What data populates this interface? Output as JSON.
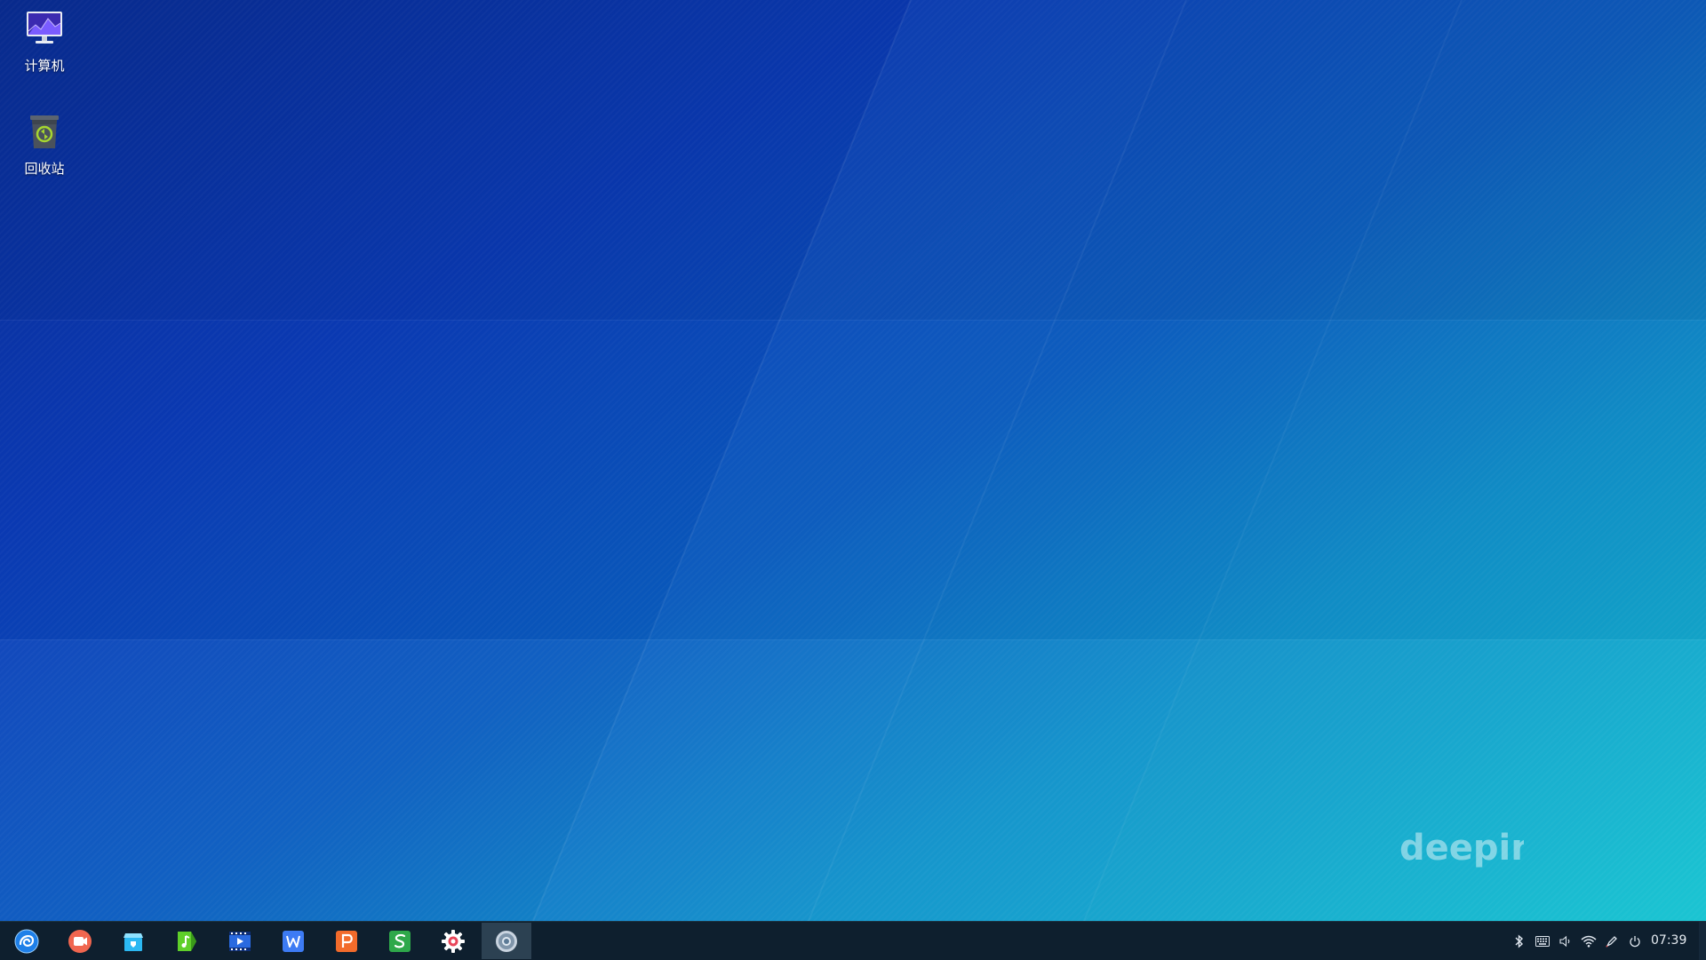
{
  "desktop": {
    "icons": [
      {
        "label": "计算机",
        "icon": "computer-icon"
      },
      {
        "label": "回收站",
        "icon": "trash-icon"
      }
    ],
    "watermark": "deepin"
  },
  "taskbar": {
    "apps": [
      {
        "name": "launcher",
        "icon": "deepin-launcher-icon",
        "active": false
      },
      {
        "name": "screen-recorder",
        "icon": "screen-recorder-icon",
        "active": false
      },
      {
        "name": "app-store",
        "icon": "app-store-icon",
        "active": false
      },
      {
        "name": "music",
        "icon": "music-icon",
        "active": false
      },
      {
        "name": "movie",
        "icon": "movie-icon",
        "active": false
      },
      {
        "name": "wps-writer",
        "icon": "wps-writer-icon",
        "active": false
      },
      {
        "name": "wps-presentation",
        "icon": "wps-presentation-icon",
        "active": false
      },
      {
        "name": "wps-spreadsheet",
        "icon": "wps-spreadsheet-icon",
        "active": false
      },
      {
        "name": "settings",
        "icon": "settings-gear-icon",
        "active": false
      },
      {
        "name": "browser",
        "icon": "browser-icon",
        "active": true
      }
    ],
    "tray": [
      "bluetooth-icon",
      "keyboard-icon",
      "volume-icon",
      "wifi-icon",
      "pen-icon",
      "power-icon"
    ],
    "clock": "07:39"
  },
  "colors": {
    "taskbar_bg": "#0e1f2e",
    "active_item_bg": "#2c4152",
    "wallpaper_dark": "#0a2e96",
    "wallpaper_light": "#10c3cf"
  }
}
